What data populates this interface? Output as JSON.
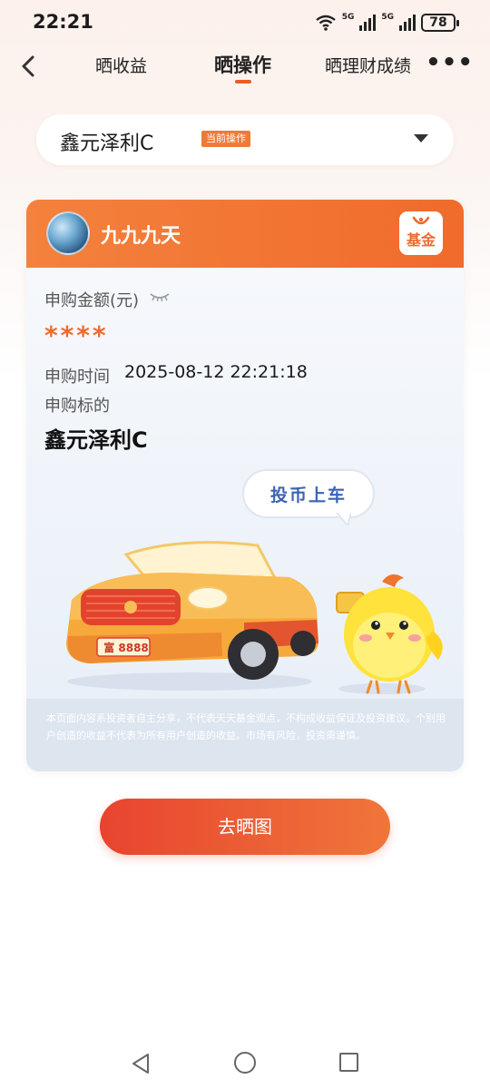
{
  "status_bar": {
    "time": "22:21",
    "net1": "5G",
    "net2": "5G",
    "battery": "78"
  },
  "nav": {
    "tabs": [
      {
        "label": "晒收益"
      },
      {
        "label": "晒操作"
      },
      {
        "label": "晒理财成绩"
      }
    ],
    "more": "•••",
    "accent_color": "#ea5b26"
  },
  "selector": {
    "fund_name": "鑫元泽利C",
    "tag": "当前操作"
  },
  "card": {
    "user_name": "九九九天",
    "logo_text": "基金",
    "amount_label": "申购金额(元)",
    "amount_value": "****",
    "time_label": "申购时间",
    "time_value": "2025-08-12 22:21:18",
    "target_label": "申购标的",
    "target_value": "鑫元泽利C",
    "bubble_text": "投币上车",
    "plate_text": "富 8888",
    "disclaimer": "本页面内容系投资者自主分享，不代表天天基金观点，不构成收益保证及投资建议。个别用户创造的收益不代表为所有用户创造的收益。市场有风险，投资需谨慎。"
  },
  "cta": {
    "label": "去晒图"
  },
  "colors": {
    "brand_orange": "#f06b2c",
    "amount_orange": "#ef6a2c",
    "bubble_blue": "#3a63b7"
  }
}
